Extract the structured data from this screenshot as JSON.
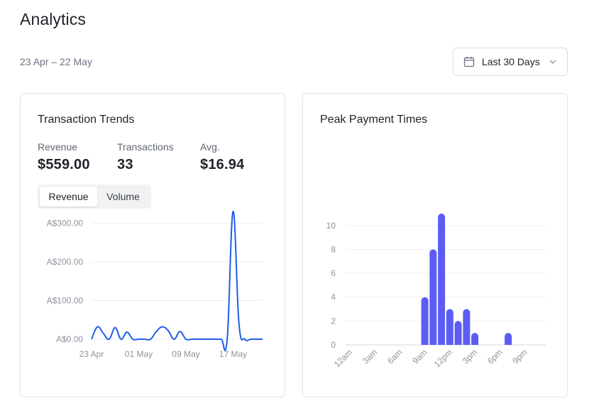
{
  "page": {
    "title": "Analytics",
    "date_range": "23 Apr – 22 May"
  },
  "period_select": {
    "value": "Last 30 Days",
    "icon": "calendar-icon"
  },
  "trends_card": {
    "title": "Transaction Trends",
    "stats": [
      {
        "label": "Revenue",
        "value": "$559.00"
      },
      {
        "label": "Transactions",
        "value": "33"
      },
      {
        "label": "Avg.",
        "value": "$16.94"
      }
    ],
    "toggle": {
      "active": "Revenue",
      "inactive": "Volume"
    }
  },
  "peak_card": {
    "title": "Peak Payment Times"
  },
  "accent_colors": {
    "line": "#1f5ee8",
    "bars": "#5c5cf5"
  },
  "chart_data": [
    {
      "type": "line",
      "x": [
        "23 Apr",
        "24 Apr",
        "25 Apr",
        "26 Apr",
        "27 Apr",
        "28 Apr",
        "29 Apr",
        "30 Apr",
        "01 May",
        "02 May",
        "03 May",
        "04 May",
        "05 May",
        "06 May",
        "07 May",
        "08 May",
        "09 May",
        "10 May",
        "11 May",
        "12 May",
        "13 May",
        "14 May",
        "15 May",
        "16 May",
        "17 May",
        "18 May",
        "19 May",
        "20 May",
        "21 May",
        "22 May"
      ],
      "x_tick_labels": [
        "23 Apr",
        "01 May",
        "09 May",
        "17 May"
      ],
      "series": [
        {
          "values": [
            0,
            32,
            15,
            0,
            30,
            0,
            18,
            0,
            0,
            0,
            0,
            20,
            32,
            22,
            0,
            20,
            0,
            0,
            0,
            0,
            0,
            0,
            0,
            0,
            330,
            40,
            0,
            0,
            0,
            0
          ]
        }
      ],
      "y_ticks": [
        "A$0.00",
        "A$100.00",
        "A$200.00",
        "A$300.00"
      ],
      "ylim": [
        0,
        330
      ],
      "grid": true
    },
    {
      "type": "bar",
      "categories": [
        "12am",
        "1am",
        "2am",
        "3am",
        "4am",
        "5am",
        "6am",
        "7am",
        "8am",
        "9am",
        "10am",
        "11am",
        "12pm",
        "1pm",
        "2pm",
        "3pm",
        "4pm",
        "5pm",
        "6pm",
        "7pm",
        "8pm",
        "9pm",
        "10pm",
        "11pm"
      ],
      "x_tick_labels": [
        "12am",
        "3am",
        "6am",
        "9am",
        "12pm",
        "3pm",
        "6pm",
        "9pm"
      ],
      "values": [
        0,
        0,
        0,
        0,
        0,
        0,
        0,
        0,
        0,
        4,
        8,
        11,
        3,
        2,
        3,
        1,
        0,
        0,
        0,
        1,
        0,
        0,
        0,
        0
      ],
      "y_ticks": [
        "0",
        "2",
        "4",
        "6",
        "8",
        "10"
      ],
      "ylim": [
        0,
        11
      ],
      "grid": true
    }
  ]
}
